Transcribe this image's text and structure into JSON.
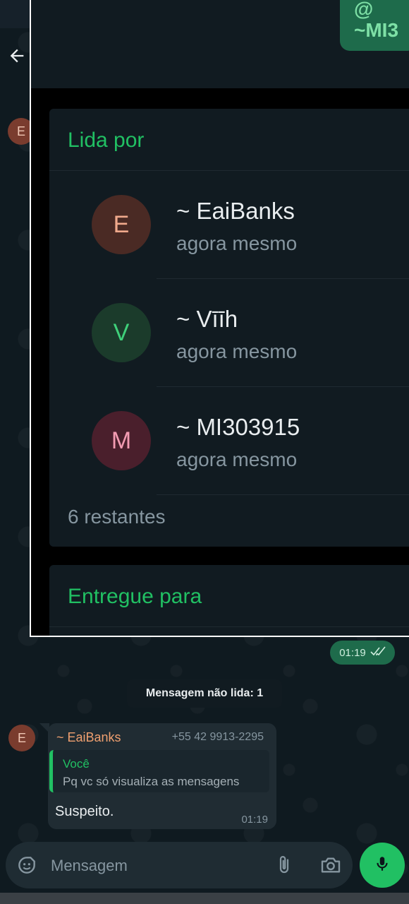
{
  "screenshot": {
    "top_bubble_text": "@\n~MI3",
    "read_by": {
      "title": "Lida por",
      "readers": [
        {
          "initial": "E",
          "name": "~ EaiBanks",
          "status": "agora mesmo",
          "bg": "#4a2a24",
          "fg": "#f0a98c"
        },
        {
          "initial": "V",
          "name": "~ Vīīh",
          "status": "agora mesmo",
          "bg": "#1b3b2b",
          "fg": "#3fd07a"
        },
        {
          "initial": "M",
          "name": "~ MI303915",
          "status": "agora mesmo",
          "bg": "#4a1f2c",
          "fg": "#f39bb2"
        }
      ],
      "remaining": "6 restantes"
    },
    "delivered": {
      "title": "Entregue para"
    }
  },
  "sent_time": "01:19",
  "unread_banner": "Mensagem não lida: 1",
  "sender_avatar_initial": "E",
  "message": {
    "sender": "~ EaiBanks",
    "phone": "+55 42 9913-2295",
    "quoted_author": "Você",
    "quoted_text": "Pq vc só visualiza as mensagens",
    "text": "Suspeito.",
    "time": "01:19"
  },
  "input": {
    "placeholder": "Mensagem"
  },
  "colors": {
    "accent": "#21c063",
    "background": "#0b141a",
    "bubble_in": "#202c33",
    "bubble_out": "#1e6b4b"
  }
}
